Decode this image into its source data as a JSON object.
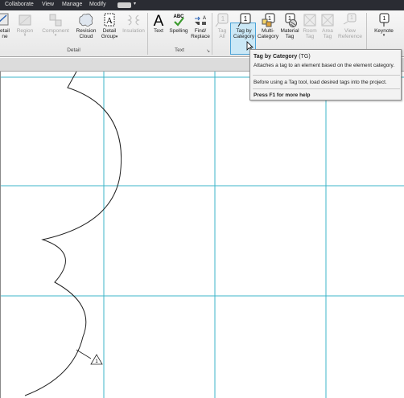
{
  "menu": [
    "Collaborate",
    "View",
    "Manage",
    "Modify"
  ],
  "ribbon": {
    "detail_panel": {
      "label": "Detail",
      "tools": [
        {
          "label": "etail",
          "label2": "ne",
          "icon": "detail-line-icon",
          "enabled": true
        },
        {
          "label": "Region",
          "icon": "region-icon",
          "enabled": false
        },
        {
          "label": "Component",
          "icon": "component-icon",
          "enabled": false
        },
        {
          "label": "Revision",
          "label2": "Cloud",
          "icon": "revision-cloud-icon",
          "enabled": true
        },
        {
          "label": "Detail",
          "label2": "Group",
          "icon": "detail-group-icon",
          "enabled": true
        },
        {
          "label": "Insulation",
          "icon": "insulation-icon",
          "enabled": false
        }
      ]
    },
    "text_panel": {
      "label": "Text",
      "tools": [
        {
          "label": "Text",
          "icon": "text-icon",
          "enabled": true
        },
        {
          "label": "Spelling",
          "glyph": "ABC",
          "icon": "spelling-icon",
          "enabled": true
        },
        {
          "label": "Find/",
          "label2": "Replace",
          "icon": "find-replace-icon",
          "enabled": true
        }
      ]
    },
    "tag_panel": {
      "tools": [
        {
          "label": "Tag",
          "label2": "All",
          "icon": "tag-all-icon",
          "enabled": false
        },
        {
          "label": "Tag by",
          "label2": "Category",
          "icon": "tag-by-category-icon",
          "enabled": true,
          "highlighted": true
        },
        {
          "label": "Multi-",
          "label2": "Category",
          "icon": "multi-category-icon",
          "enabled": true
        },
        {
          "label": "Material",
          "label2": "Tag",
          "icon": "material-tag-icon",
          "enabled": true
        },
        {
          "label": "Room",
          "label2": "Tag",
          "icon": "room-tag-icon",
          "enabled": false
        },
        {
          "label": "Area",
          "label2": "Tag",
          "icon": "area-tag-icon",
          "enabled": false
        },
        {
          "label": "View",
          "label2": "Reference",
          "icon": "view-reference-icon",
          "enabled": false
        },
        {
          "label": "Keynote",
          "icon": "keynote-icon",
          "enabled": true
        }
      ]
    },
    "tag_glyph": "1"
  },
  "tooltip": {
    "title": "Tag by Category",
    "shortcut": "(TG)",
    "description": "Attaches a tag to an element based on the element category.",
    "note": "Before using a Tag tool, load desired tags into the project.",
    "help": "Press F1 for more help"
  },
  "canvas": {
    "grid_color": "#3cb6c8",
    "tag_glyph": "1"
  }
}
